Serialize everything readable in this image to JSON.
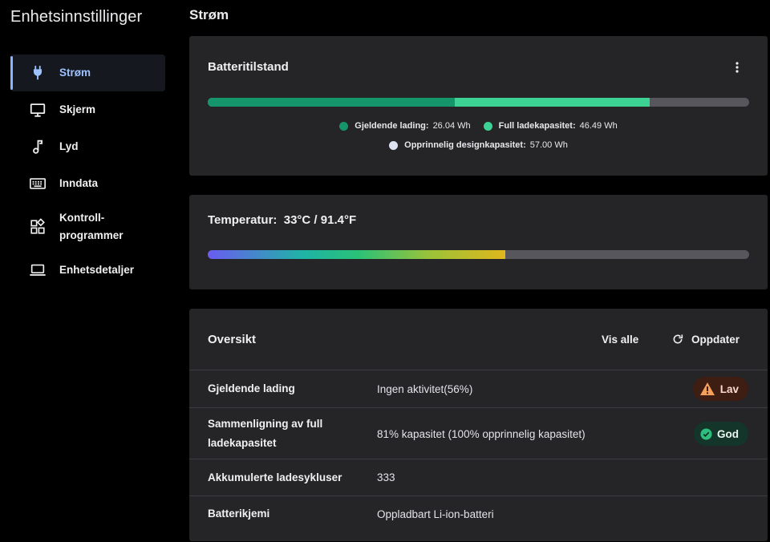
{
  "app": {
    "title": "Enhetsinnstillinger"
  },
  "sidebar": {
    "items": [
      {
        "label": "Strøm",
        "icon": "plug-icon",
        "active": true
      },
      {
        "label": "Skjerm",
        "icon": "monitor-icon",
        "active": false
      },
      {
        "label": "Lyd",
        "icon": "music-note-icon",
        "active": false
      },
      {
        "label": "Inndata",
        "icon": "keyboard-icon",
        "active": false
      },
      {
        "label": "Kontroll-\nprogrammer",
        "icon": "widgets-icon",
        "active": false
      },
      {
        "label": "Enhetsdetaljer",
        "icon": "laptop-icon",
        "active": false
      }
    ]
  },
  "page": {
    "title": "Strøm"
  },
  "battery": {
    "title": "Batteritilstand",
    "current_charge": {
      "label": "Gjeldende lading:",
      "value": "26.04 Wh",
      "wh": 26.04,
      "color": "#15956a"
    },
    "full_capacity": {
      "label": "Full ladekapasitet:",
      "value": "46.49 Wh",
      "wh": 46.49,
      "color": "#3bd294"
    },
    "design_capacity": {
      "label": "Opprinnelig designkapasitet:",
      "value": "57.00 Wh",
      "wh": 57.0,
      "color": "#dde3f0"
    }
  },
  "temperature": {
    "label": "Temperatur:",
    "value": "33°C / 91.4°F",
    "fill_fraction": 0.55
  },
  "overview": {
    "title": "Oversikt",
    "view_all": "Vis alle",
    "refresh": "Oppdater",
    "rows": [
      {
        "label": "Gjeldende lading",
        "value": "Ingen aktivitet(56%)",
        "badge": "Lav",
        "badge_type": "low"
      },
      {
        "label": "Sammenligning av full ladekapasitet",
        "value": "81% kapasitet (100% opprinnelig kapasitet)",
        "badge": "God",
        "badge_type": "good"
      },
      {
        "label": "Akkumulerte ladesykluser",
        "value": "333"
      },
      {
        "label": "Batterikjemi",
        "value": "Oppladbart Li-ion-batteri"
      }
    ]
  },
  "colors": {
    "accent": "#8ab4ff",
    "warning": "#f5a05a",
    "success": "#2fbd7d"
  }
}
